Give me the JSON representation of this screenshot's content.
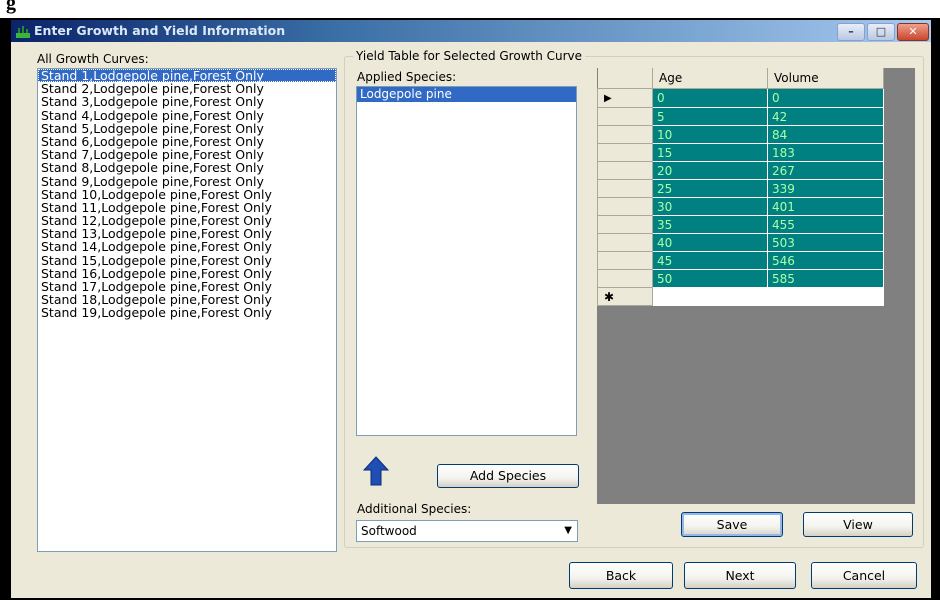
{
  "window": {
    "title": "Enter Growth and Yield Information",
    "controls": {
      "minimize": "–",
      "maximize": "□",
      "close": "✕"
    }
  },
  "colors": {
    "selection": "#316ac5",
    "grid_cell_bg": "#008080",
    "grid_cell_text": "#a8ffa8",
    "accent_arrow": "#1f4fb4"
  },
  "growth_curves": {
    "label": "All Growth Curves:",
    "items": [
      "Stand 1,Lodgepole pine,Forest Only",
      "Stand 2,Lodgepole pine,Forest Only",
      "Stand 3,Lodgepole pine,Forest Only",
      "Stand 4,Lodgepole pine,Forest Only",
      "Stand 5,Lodgepole pine,Forest Only",
      "Stand 6,Lodgepole pine,Forest Only",
      "Stand 7,Lodgepole pine,Forest Only",
      "Stand 8,Lodgepole pine,Forest Only",
      "Stand 9,Lodgepole pine,Forest Only",
      "Stand 10,Lodgepole pine,Forest Only",
      "Stand 11,Lodgepole pine,Forest Only",
      "Stand 12,Lodgepole pine,Forest Only",
      "Stand 13,Lodgepole pine,Forest Only",
      "Stand 14,Lodgepole pine,Forest Only",
      "Stand 15,Lodgepole pine,Forest Only",
      "Stand 16,Lodgepole pine,Forest Only",
      "Stand 17,Lodgepole pine,Forest Only",
      "Stand 18,Lodgepole pine,Forest Only",
      "Stand 19,Lodgepole pine,Forest Only"
    ]
  },
  "yield_group": {
    "title": "Yield Table for Selected Growth Curve",
    "applied_species_label": "Applied Species:",
    "applied_species": [
      "Lodgepole pine"
    ],
    "add_species_button": "Add Species",
    "additional_species_label": "Additional Species:",
    "additional_species_value": "Softwood",
    "combo_arrow": "▼",
    "up_arrow_icon": "up-arrow-icon",
    "save_button": "Save",
    "view_button": "View"
  },
  "yield_table": {
    "columns": [
      "Age",
      "Volume"
    ],
    "current_row_marker": "▶",
    "new_row_marker": "✱",
    "rows": [
      [
        "0",
        "0"
      ],
      [
        "5",
        "42"
      ],
      [
        "10",
        "84"
      ],
      [
        "15",
        "183"
      ],
      [
        "20",
        "267"
      ],
      [
        "25",
        "339"
      ],
      [
        "30",
        "401"
      ],
      [
        "35",
        "455"
      ],
      [
        "40",
        "503"
      ],
      [
        "45",
        "546"
      ],
      [
        "50",
        "585"
      ]
    ]
  },
  "footer": {
    "back": "Back",
    "next": "Next",
    "cancel": "Cancel"
  }
}
